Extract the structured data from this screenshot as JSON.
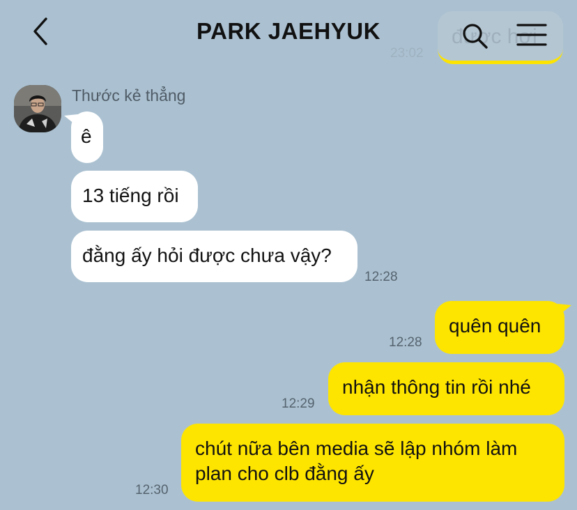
{
  "header": {
    "title": "PARK JAEHYUK",
    "back_icon": "chevron-left-icon",
    "search_icon": "search-icon",
    "menu_icon": "hamburger-menu-icon"
  },
  "scrolled_bubble": {
    "text": "được hơi",
    "time": "23:02"
  },
  "incoming": {
    "sender": "Thước kẻ thẳng",
    "messages": [
      {
        "text": "ê"
      },
      {
        "text": "13 tiếng rồi"
      },
      {
        "text": "đằng ấy hỏi được chưa vậy?",
        "time": "12:28"
      }
    ]
  },
  "outgoing": [
    {
      "text": "quên quên",
      "time": "12:28"
    },
    {
      "text": "nhận thông tin rồi nhé",
      "time": "12:29"
    },
    {
      "text": "chút nữa bên media sẽ lập nhóm làm plan cho clb đằng ấy",
      "line1": "chút nữa bên media sẽ lập nhóm làm",
      "line2": "plan cho clb đằng ấy",
      "time": "12:30"
    }
  ],
  "colors": {
    "background": "#abc1d1",
    "outgoing_bubble": "#fee500",
    "incoming_bubble": "#ffffff"
  }
}
